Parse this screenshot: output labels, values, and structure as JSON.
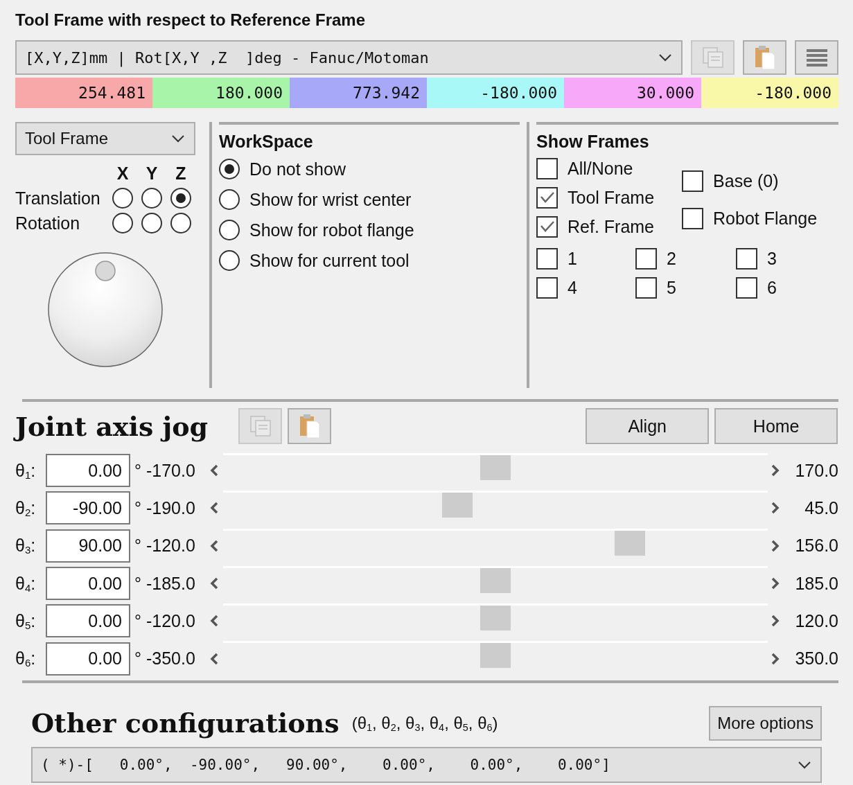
{
  "pose": {
    "title": "Tool Frame with respect to Reference Frame",
    "format": "[X,Y,Z]mm | Rot[X,Y ,Z  ]deg - Fanuc/Motoman",
    "tools": [
      {
        "kind": "copy",
        "disabled": true
      },
      {
        "kind": "paste",
        "disabled": false
      },
      {
        "kind": "menu",
        "disabled": false
      }
    ],
    "values": [
      {
        "text": "254.481",
        "color": "#f8a8a8"
      },
      {
        "text": "180.000",
        "color": "#a8f4a8"
      },
      {
        "text": "773.942",
        "color": "#a8a8f8"
      },
      {
        "text": "-180.000",
        "color": "#a8f8f8"
      },
      {
        "text": "30.000",
        "color": "#f8a8f8"
      },
      {
        "text": "-180.000",
        "color": "#f8f8a8"
      }
    ]
  },
  "frame_select": "Tool Frame",
  "axes": {
    "headers": [
      "X",
      "Y",
      "Z"
    ],
    "rows": [
      {
        "label": "Translation",
        "options": [
          {
            "selected": false
          },
          {
            "selected": false
          },
          {
            "selected": true
          }
        ]
      },
      {
        "label": "Rotation",
        "options": [
          {
            "selected": false
          },
          {
            "selected": false
          },
          {
            "selected": false
          }
        ]
      }
    ]
  },
  "workspace": {
    "title": "WorkSpace",
    "options": [
      {
        "label": "Do not show",
        "selected": true
      },
      {
        "label": "Show for wrist center",
        "selected": false
      },
      {
        "label": "Show for robot flange",
        "selected": false
      },
      {
        "label": "Show for current tool",
        "selected": false
      }
    ]
  },
  "show_frames": {
    "title": "Show Frames",
    "primary": [
      {
        "label": "All/None",
        "checked": false
      },
      {
        "label": "Tool Frame",
        "checked": true
      },
      {
        "label": "Ref. Frame",
        "checked": true
      }
    ],
    "secondary": [
      {
        "label": "Base (0)",
        "checked": false
      },
      {
        "label": "Robot Flange",
        "checked": false
      }
    ],
    "numbered": [
      {
        "label": "1",
        "checked": false
      },
      {
        "label": "2",
        "checked": false
      },
      {
        "label": "3",
        "checked": false
      },
      {
        "label": "4",
        "checked": false
      },
      {
        "label": "5",
        "checked": false
      },
      {
        "label": "6",
        "checked": false
      }
    ]
  },
  "joint_jog": {
    "title": "Joint axis jog",
    "tools": [
      {
        "kind": "copy",
        "disabled": true
      },
      {
        "kind": "paste",
        "disabled": false
      }
    ],
    "actions": [
      "Align",
      "Home"
    ],
    "joints": [
      {
        "label": "θ$_{1}$:",
        "value": "0.00",
        "unit": "°",
        "min": "-170.0",
        "max": "170.0",
        "level": 0.5
      },
      {
        "label": "θ$_{2}$:",
        "value": "-90.00",
        "unit": "°",
        "min": "-190.0",
        "max": "45.0",
        "level": 0.426
      },
      {
        "label": "θ$_{3}$:",
        "value": "90.00",
        "unit": "°",
        "min": "-120.0",
        "max": "156.0",
        "level": 0.761
      },
      {
        "label": "θ$_{4}$:",
        "value": "0.00",
        "unit": "°",
        "min": "-185.0",
        "max": "185.0",
        "level": 0.5
      },
      {
        "label": "θ$_{5}$:",
        "value": "0.00",
        "unit": "°",
        "min": "-120.0",
        "max": "120.0",
        "level": 0.5
      },
      {
        "label": "θ$_{6}$:",
        "value": "0.00",
        "unit": "°",
        "min": "-350.0",
        "max": "350.0",
        "level": 0.5
      }
    ]
  },
  "other_configurations": {
    "title": "Other configurations",
    "subtitle": "(θ$_{1}$, θ$_{2}$, θ$_{3}$, θ$_{4}$, θ$_{5}$, θ$_{6}$)",
    "button": "More options",
    "selection": "( *)-[   0.00°,  -90.00°,   90.00°,    0.00°,    0.00°,    0.00°]"
  }
}
